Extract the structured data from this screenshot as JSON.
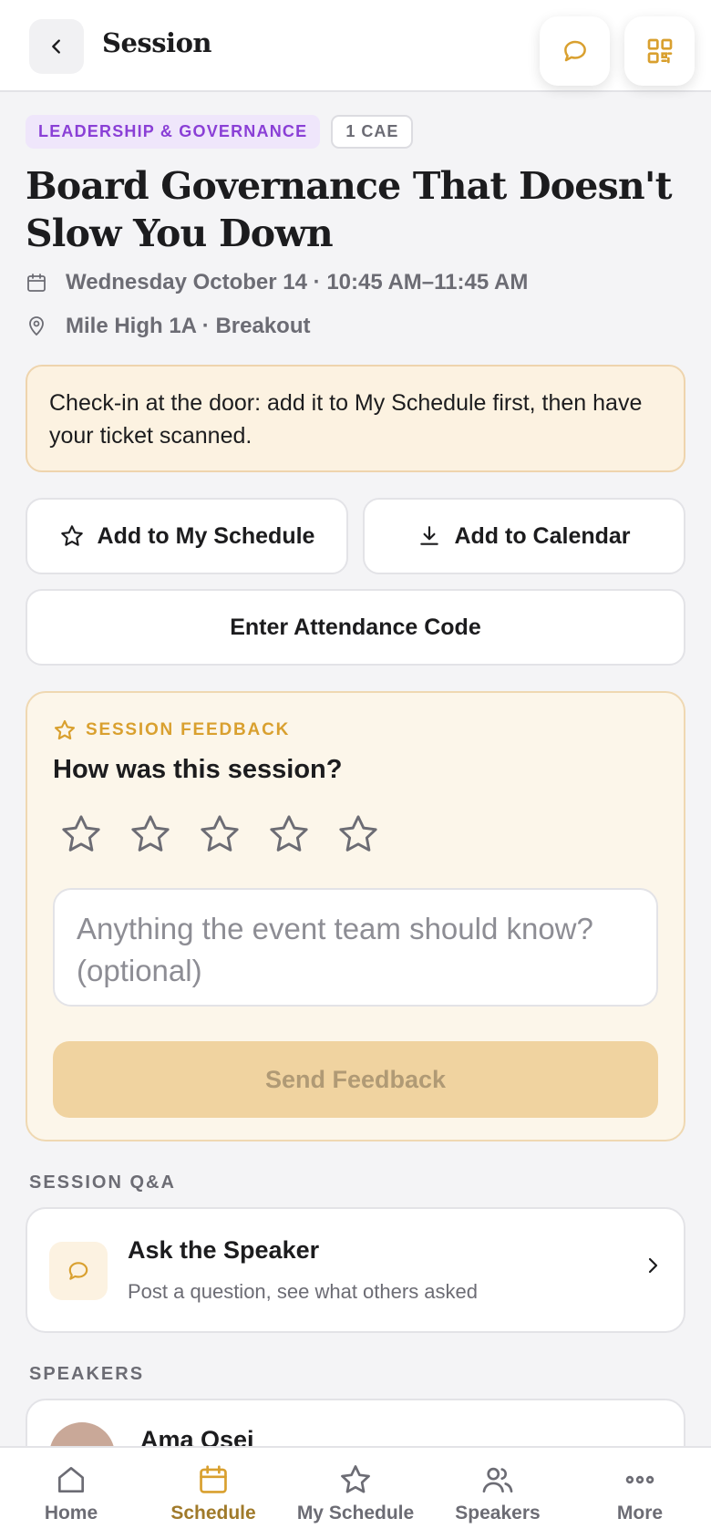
{
  "header": {
    "title": "Session",
    "icons": {
      "back": "chevron-left-icon",
      "chat": "chat-bubble-icon",
      "qr": "qr-code-icon"
    }
  },
  "session": {
    "category_tag": "LEADERSHIP & GOVERNANCE",
    "credit_tag": "1 CAE",
    "title": "Board Governance That Doesn't Slow You Down",
    "datetime": "Wednesday October 14 · 10:45 AM–11:45 AM",
    "location": "Mile High 1A · Breakout"
  },
  "notice": {
    "text": "Check-in at the door: add it to My Schedule first, then have your ticket scanned."
  },
  "actions": {
    "add_schedule": "Add to My Schedule",
    "add_calendar": "Add to Calendar",
    "attendance_code": "Enter Attendance Code"
  },
  "feedback": {
    "kicker": "SESSION FEEDBACK",
    "question": "How was this session?",
    "rating": 0,
    "rating_max": 5,
    "placeholder": "Anything the event team should know? (optional)",
    "send_label": "Send Feedback"
  },
  "qa": {
    "section_label": "SESSION Q&A",
    "title": "Ask the Speaker",
    "subtitle": "Post a question, see what others asked"
  },
  "speakers": {
    "section_label": "SPEAKERS",
    "items": [
      {
        "name": "Ama Osei"
      }
    ]
  },
  "tabbar": {
    "items": [
      {
        "label": "Home",
        "icon": "home-icon",
        "active": false
      },
      {
        "label": "Schedule",
        "icon": "calendar-icon",
        "active": true
      },
      {
        "label": "My Schedule",
        "icon": "star-icon",
        "active": false
      },
      {
        "label": "Speakers",
        "icon": "people-icon",
        "active": false
      },
      {
        "label": "More",
        "icon": "more-dots-icon",
        "active": false
      }
    ]
  },
  "colors": {
    "accent": "#d9a02f",
    "category_purple": "#8a3fd6",
    "active_tab": "#a07a2a"
  }
}
